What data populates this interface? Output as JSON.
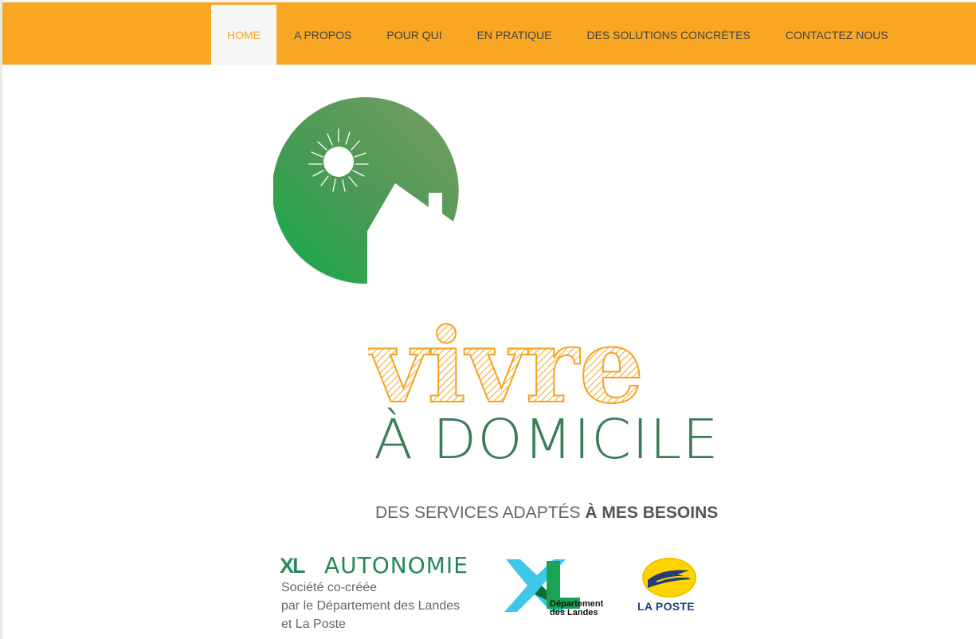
{
  "nav": {
    "items": [
      {
        "label": "HOME",
        "active": true
      },
      {
        "label": "A PROPOS",
        "active": false
      },
      {
        "label": "POUR QUI",
        "active": false
      },
      {
        "label": "EN PRATIQUE",
        "active": false
      },
      {
        "label": "DES SOLUTIONS CONCRÈTES",
        "active": false
      },
      {
        "label": "CONTACTEZ NOUS",
        "active": false
      }
    ]
  },
  "hero": {
    "title_top": "vivre",
    "title_bottom": "À DOMICILE",
    "tagline_prefix": "DES SERVICES ADAPTÉS",
    "tagline_strong": "À MES BESOINS",
    "icon": "house-sun-icon"
  },
  "footer_brand": {
    "xl": "XL",
    "name": "AUTONOMIE",
    "lines": [
      "Société co-créée",
      "par le Département des Landes",
      "et La Poste"
    ]
  },
  "partners": {
    "departement": "Département",
    "landes": "des Landes",
    "laposte": "LA POSTE"
  },
  "colors": {
    "nav_bg": "#f9a623",
    "nav_active_bg": "#f6f6f6",
    "accent": "#f5a623",
    "green": "#3b7d58",
    "tagline": "#666666"
  }
}
